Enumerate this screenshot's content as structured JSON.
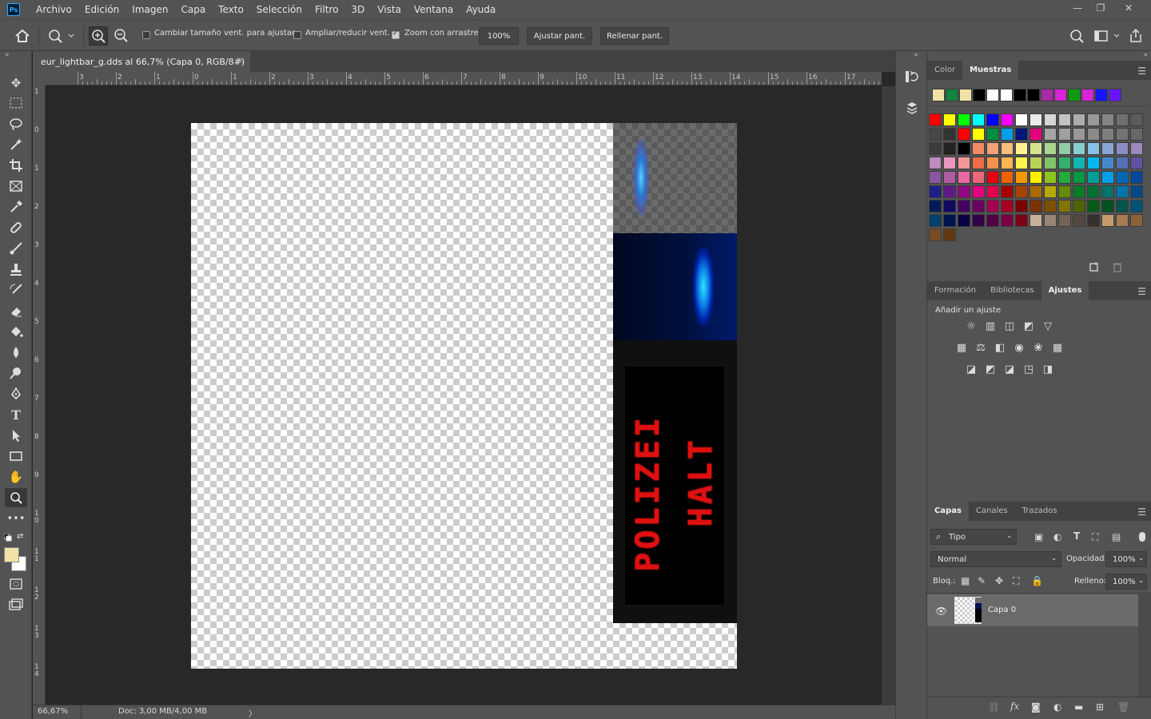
{
  "app": {
    "logo_text": "Ps",
    "menu": [
      "Archivo",
      "Edición",
      "Imagen",
      "Capa",
      "Texto",
      "Selección",
      "Filtro",
      "3D",
      "Vista",
      "Ventana",
      "Ayuda"
    ],
    "window_controls": {
      "minimize": "—",
      "restore": "❐",
      "close": "✕"
    }
  },
  "options_bar": {
    "checkbox_resize": "Cambiar tamaño vent. para ajustar",
    "checkbox_resize_checked": false,
    "checkbox_zoom_all": "Ampliar/reducir vent.",
    "checkbox_zoom_all_checked": false,
    "checkbox_scrubby": "Zoom con arrastre",
    "checkbox_scrubby_checked": true,
    "zoom_value": "100%",
    "fit_screen": "Ajustar pant.",
    "fill_screen": "Rellenar pant."
  },
  "document": {
    "tab_title": "eur_lightbar_g.dds al 66,7% (Capa 0, RGB/8#)",
    "tab_close": "×",
    "ruler_h": [
      "3",
      "2",
      "1",
      "0",
      "1",
      "2",
      "3",
      "4",
      "5",
      "6",
      "7",
      "8",
      "9",
      "10",
      "11",
      "12",
      "13",
      "14",
      "15",
      "16",
      "17"
    ],
    "ruler_v": [
      "1",
      "0",
      "1",
      "2",
      "3",
      "4",
      "5",
      "6",
      "7",
      "8",
      "9",
      "1 0",
      "1 1",
      "1 2",
      "1 3",
      "1 4"
    ],
    "led_text_left": "POLIZEI",
    "led_text_right": "HALT"
  },
  "status": {
    "zoom": "66,67%",
    "doc_size": "Doc: 3,00 MB/4,00 MB",
    "arrow": "〉"
  },
  "swatches_panel": {
    "tabs": [
      "Color",
      "Muestras"
    ],
    "active_tab": "Muestras",
    "recent": [
      "#f1e3a5",
      "#138442",
      "#f1e3a5",
      "#000000",
      "#ffffff",
      "#ffffff",
      "#000000",
      "#000000",
      "#a629a6",
      "#d624d6",
      "#119a11",
      "#d624d6",
      "#1515ff",
      "#6914ff"
    ],
    "rows": [
      [
        "#ff0000",
        "#ffff00",
        "#00ff00",
        "#00ffff",
        "#0000ff",
        "#ff00ff",
        "#ffffff",
        "#ebebeb",
        "#d6d6d6",
        "#c2c2c2",
        "#adadad",
        "#999999",
        "#858585",
        "#707070",
        "#5c5c5c"
      ],
      [
        "#474747",
        "#333333",
        "#ff0000",
        "#ffff00",
        "#008f3d",
        "#00a0e9",
        "#00177a",
        "#e4007f",
        "#a5a5a5",
        "#a0a0a0",
        "#999999",
        "#8a8a8a",
        "#7e7e7e",
        "#737373",
        "#686868"
      ],
      [
        "#3c3c3c",
        "#222222",
        "#000000",
        "#f08b66",
        "#f2a179",
        "#f6bd7c",
        "#fff38f",
        "#d7e48f",
        "#a9d58f",
        "#93cba6",
        "#87cdd0",
        "#88c2e8",
        "#8aa6d6",
        "#8b8ec5",
        "#9f87bf"
      ],
      [
        "#bd8abe",
        "#ed96c0",
        "#f39797",
        "#ee6b47",
        "#f19149",
        "#f8b552",
        "#fff34b",
        "#b8d259",
        "#80c269",
        "#32b16c",
        "#13b5b1",
        "#00b7ee",
        "#448aca",
        "#556fb5",
        "#5f52a0"
      ],
      [
        "#8957a1",
        "#ae5da1",
        "#ea68a2",
        "#eb6877",
        "#e60012",
        "#eb6100",
        "#f39800",
        "#fff100",
        "#8fc31f",
        "#22ac38",
        "#009944",
        "#009e96",
        "#00a0e9",
        "#0068b7",
        "#00479d"
      ],
      [
        "#1d2088",
        "#601986",
        "#920783",
        "#e4007f",
        "#e5004f",
        "#a40000",
        "#a84200",
        "#ac6a00",
        "#b7aa00",
        "#638c0b",
        "#097c25",
        "#007130",
        "#00736d",
        "#0075a9",
        "#004986"
      ],
      [
        "#001c58",
        "#100964",
        "#440062",
        "#6a005f",
        "#a4004f",
        "#a50021",
        "#7d0000",
        "#7c3100",
        "#7f4f00",
        "#817500",
        "#4d6500",
        "#085b17",
        "#005121",
        "#00554d",
        "#005378"
      ],
      [
        "#003f6e",
        "#00134e",
        "#080244",
        "#33004a",
        "#500047",
        "#7a0046",
        "#7d0016",
        "#c7b299",
        "#998675",
        "#736357",
        "#534741",
        "#37302e",
        "#c69c6d",
        "#a67c52",
        "#8c6239"
      ],
      [
        "#754c24",
        "#603913"
      ]
    ]
  },
  "adjust_panel": {
    "tabs": [
      "Formación",
      "Bibliotecas",
      "Ajustes"
    ],
    "active_tab": "Ajustes",
    "heading": "Añadir un ajuste",
    "row1": [
      "☼",
      "▥",
      "◫",
      "◩",
      "▽"
    ],
    "row2": [
      "▦",
      "⚖",
      "◧",
      "◉",
      "❀",
      "▦"
    ],
    "row3": [
      "◪",
      "◩",
      "◪",
      "◳",
      "◨"
    ]
  },
  "layers_panel": {
    "tabs": [
      "Capas",
      "Canales",
      "Trazados"
    ],
    "active_tab": "Capas",
    "filter_label": "Tipo",
    "blend_mode": "Normal",
    "opacity_label": "Opacidad:",
    "opacity_value": "100%",
    "lock_label": "Bloq.:",
    "fill_label": "Relleno:",
    "fill_value": "100%",
    "layers": [
      {
        "name": "Capa 0",
        "visible": true
      }
    ]
  }
}
